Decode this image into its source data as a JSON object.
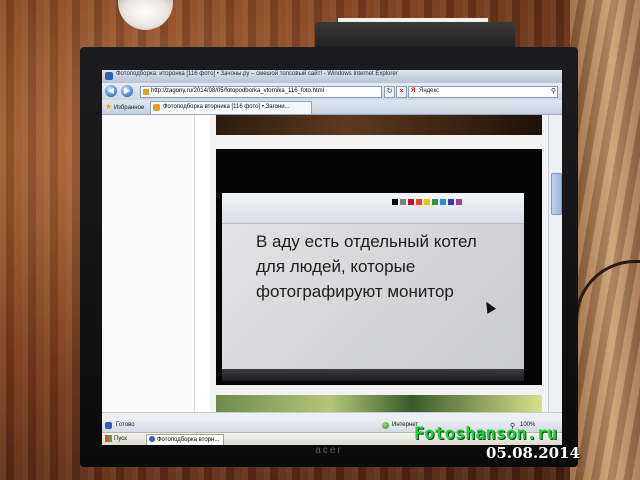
{
  "browser": {
    "title": "Фотоподборка: иторонка [116 фото] • Зачоны.ру – смешой топсовый сайт! - Windows Internet Explorer",
    "address": "http://zagony.ru/2014/08/05/fotopodborka_vtornika_116_foto.html",
    "search_placeholder": "Яндекс",
    "favorites_label": "Избранное",
    "tab_title": "Фотоподборка вторника [116 фото] • Загони...",
    "status_text": "Готово",
    "zone_label": "Интернет",
    "zoom_label": "100%"
  },
  "taskbar": {
    "start_label": "Пуск",
    "task_label": "Фотоподборка вторн..."
  },
  "photo_text": {
    "line1": "В аду есть отдельный котел",
    "line2": "для людей, которые",
    "line3": "фотографируют монитор"
  },
  "monitor": {
    "brand": "acer"
  },
  "watermark": {
    "site": "Fotoshanson.ru",
    "date": "05.08.2014"
  },
  "colors": {
    "watermark_green": "#19d33b",
    "watermark_date": "#ffffff",
    "room_wall": "#7a3c1e"
  }
}
